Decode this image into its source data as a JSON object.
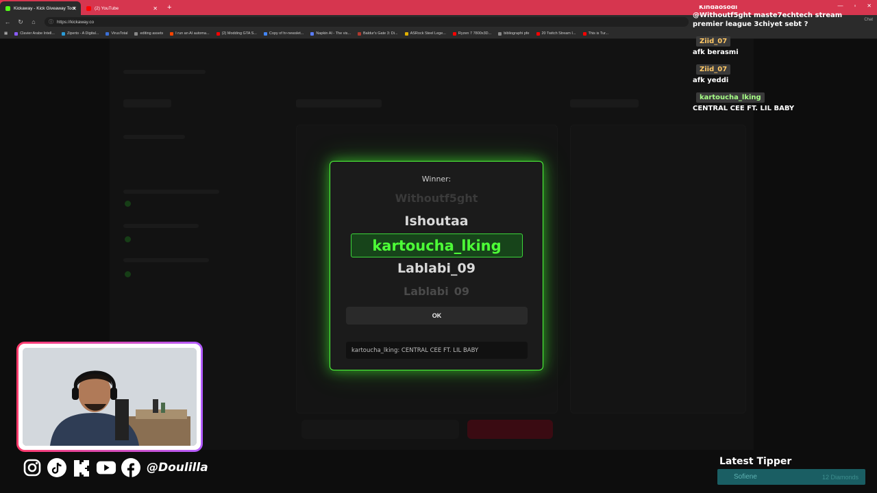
{
  "browser": {
    "tabs": [
      {
        "title": "Kickaway - Kick Giveaway Tool",
        "active": true,
        "favicon_color": "#53fc18"
      },
      {
        "title": "(2) YouTube",
        "active": false,
        "favicon_color": "#ff0000"
      }
    ],
    "url": "https://kickaway.co",
    "bookmarks": [
      {
        "label": "Clavier Arabe Intell...",
        "color": "#8a5cff"
      },
      {
        "label": "Ziperto - A Digital...",
        "color": "#2a9bd6"
      },
      {
        "label": "VirusTotal",
        "color": "#3b6fd6"
      },
      {
        "label": "editing assets",
        "color": "#888888"
      },
      {
        "label": "I run an AI automa...",
        "color": "#ff4500"
      },
      {
        "label": "(2) Modding GTA S...",
        "color": "#ff0000"
      },
      {
        "label": "Copy of hr-newslet...",
        "color": "#4285f4"
      },
      {
        "label": "Napkin AI - The vis...",
        "color": "#5a7dff"
      },
      {
        "label": "Baldur's Gate 3: Di...",
        "color": "#b0392e"
      },
      {
        "label": "ASRock Steel Lege...",
        "color": "#e0b000"
      },
      {
        "label": "Ryzen 7 7800x3D...",
        "color": "#ff0000"
      },
      {
        "label": "bibliographi pfe",
        "color": "#888888"
      },
      {
        "label": "20 Twitch Stream I...",
        "color": "#ff0000"
      },
      {
        "label": "This is Tur...",
        "color": "#ff0000"
      }
    ],
    "chat_icon_label": "Chat"
  },
  "modal": {
    "label": "Winner:",
    "reel_top": "Withoutf5ght",
    "reel_2": "Ishoutaa",
    "winner": "kartoucha_lking",
    "reel_4": "Lablabi_09",
    "reel_bottom": "Lablabi_09",
    "ok_label": "OK",
    "message": "kartoucha_lking: CENTRAL CEE FT. LIL BABY"
  },
  "chat": {
    "top_name": "Kindaosodi",
    "messages": [
      {
        "name": "",
        "text": "@Withoutf5ght maste7echtech stream premier league 3chiyet sebt ?"
      },
      {
        "name": "Ziid_07",
        "text": "afk berasmi",
        "color": "orange"
      },
      {
        "name": "Ziid_07",
        "text": "afk yeddi",
        "color": "orange"
      },
      {
        "name": "kartoucha_lking",
        "text": "CENTRAL CEE FT. LIL BABY",
        "color": "green"
      }
    ]
  },
  "socials": {
    "handle": "@Doulilla",
    "icons": [
      "instagram-icon",
      "tiktok-icon",
      "kick-icon",
      "youtube-icon",
      "facebook-icon"
    ]
  },
  "tipper": {
    "title": "Latest Tipper",
    "name": "Sofiene",
    "amount": "12 Diamonds"
  }
}
